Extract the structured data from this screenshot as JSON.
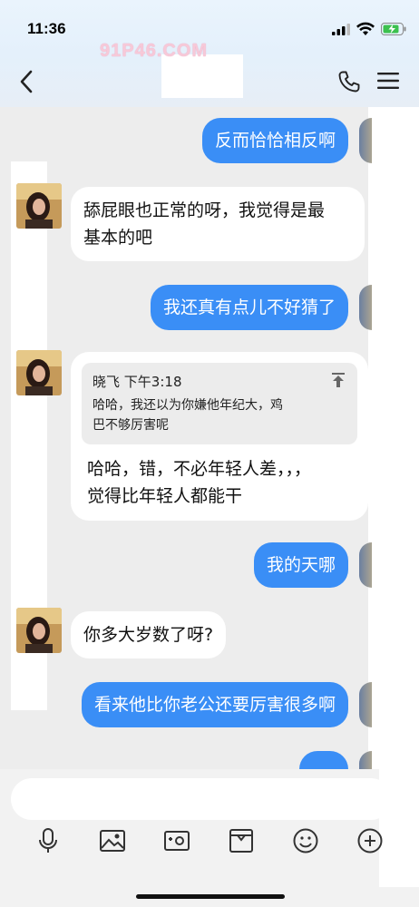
{
  "status": {
    "time": "11:36"
  },
  "watermark": "91P46.COM",
  "nav": {
    "title": ""
  },
  "messages": [
    {
      "dir": "out",
      "text": "反而恰恰相反啊"
    },
    {
      "dir": "in",
      "text_lines": [
        "舔屁眼也正常的呀，我觉得是最",
        "基本的吧"
      ]
    },
    {
      "dir": "out",
      "text": "我还真有点儿不好猜了"
    },
    {
      "dir": "in",
      "quote": {
        "author": "晓飞",
        "time": "下午3:18",
        "lines": [
          "哈哈，我还以为你嫌他年纪大，鸡",
          "巴不够厉害呢"
        ]
      },
      "text_lines": [
        "哈哈，错，不必年轻人差，，，",
        "觉得比年轻人都能干"
      ]
    },
    {
      "dir": "out",
      "text": "我的天哪"
    },
    {
      "dir": "in",
      "text": "你多大岁数了呀?"
    },
    {
      "dir": "out",
      "text": "看来他比你老公还要厉害很多啊"
    },
    {
      "dir": "out",
      "text": ""
    }
  ],
  "input": {
    "placeholder": ""
  },
  "toolbar": [
    "microphone-icon",
    "image-icon",
    "camera-icon",
    "box-icon",
    "emoji-icon",
    "plus-icon"
  ]
}
